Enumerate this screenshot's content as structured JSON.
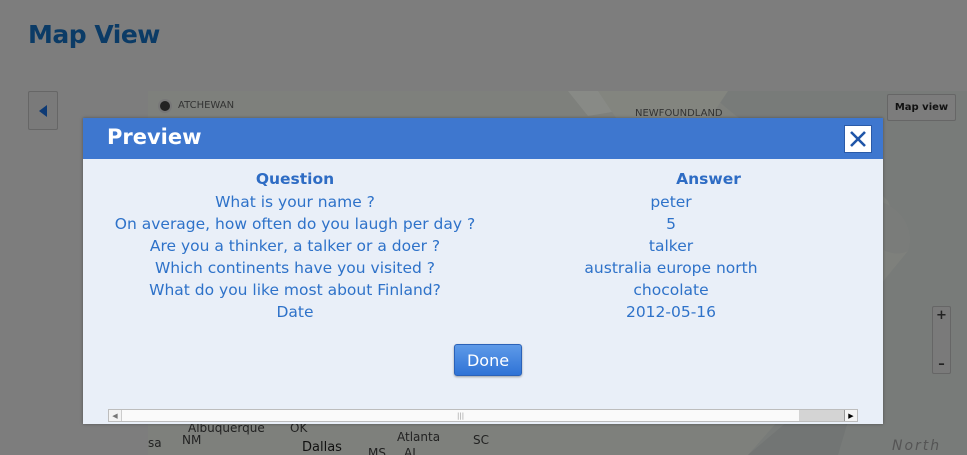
{
  "page": {
    "title": "Map View"
  },
  "map": {
    "view_button_label": "Map view",
    "zoom_in_label": "+",
    "zoom_out_label": "–",
    "labels": {
      "saskatchewan": "ATCHEWAN",
      "newfoundland": "NEWFOUNDLAND",
      "albuquerque": "Albuquerque",
      "nm": "NM",
      "ok": "OK",
      "dallas": "Dallas",
      "atlanta": "Atlanta",
      "sc": "SC",
      "ms": "MS",
      "al": "AL",
      "sa": "sa",
      "north": "North"
    }
  },
  "modal": {
    "title": "Preview",
    "question_header": "Question",
    "answer_header": "Answer",
    "rows": [
      {
        "question": "What is your name ?",
        "answer": "peter"
      },
      {
        "question": "On average, how often do you laugh per day ?",
        "answer": "5"
      },
      {
        "question": "Are you a thinker, a talker or a doer ?",
        "answer": "talker"
      },
      {
        "question": "Which continents have you visited ?",
        "answer": "australia europe north"
      },
      {
        "question": "What do you like most about Finland?",
        "answer": "chocolate"
      },
      {
        "question": "Date",
        "answer": "2012-05-16"
      }
    ],
    "done_label": "Done"
  },
  "colors": {
    "header_blue": "#3e77cf",
    "text_blue": "#2e72c9",
    "title_navy": "#0b3b66"
  }
}
